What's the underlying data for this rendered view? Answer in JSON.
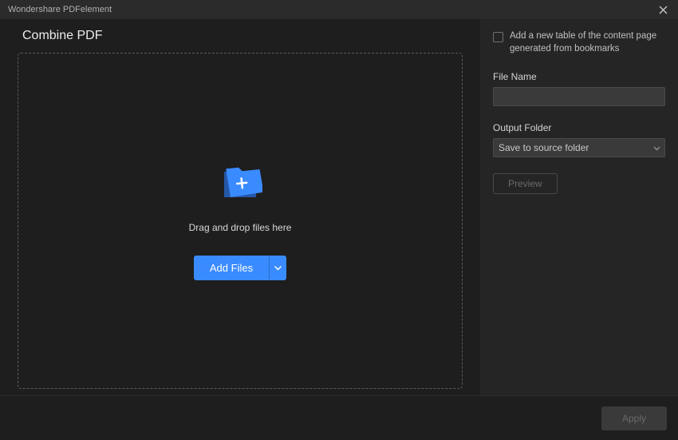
{
  "titlebar": {
    "app_name": "Wondershare PDFelement"
  },
  "page": {
    "title": "Combine PDF",
    "drop_hint": "Drag and drop files here",
    "add_files_label": "Add Files"
  },
  "sidebar": {
    "toc_checkbox_label": "Add a new table of the content page generated from bookmarks",
    "file_name_label": "File Name",
    "file_name_value": "",
    "output_folder_label": "Output Folder",
    "output_folder_value": "Save to source folder",
    "preview_label": "Preview"
  },
  "footer": {
    "apply_label": "Apply"
  }
}
